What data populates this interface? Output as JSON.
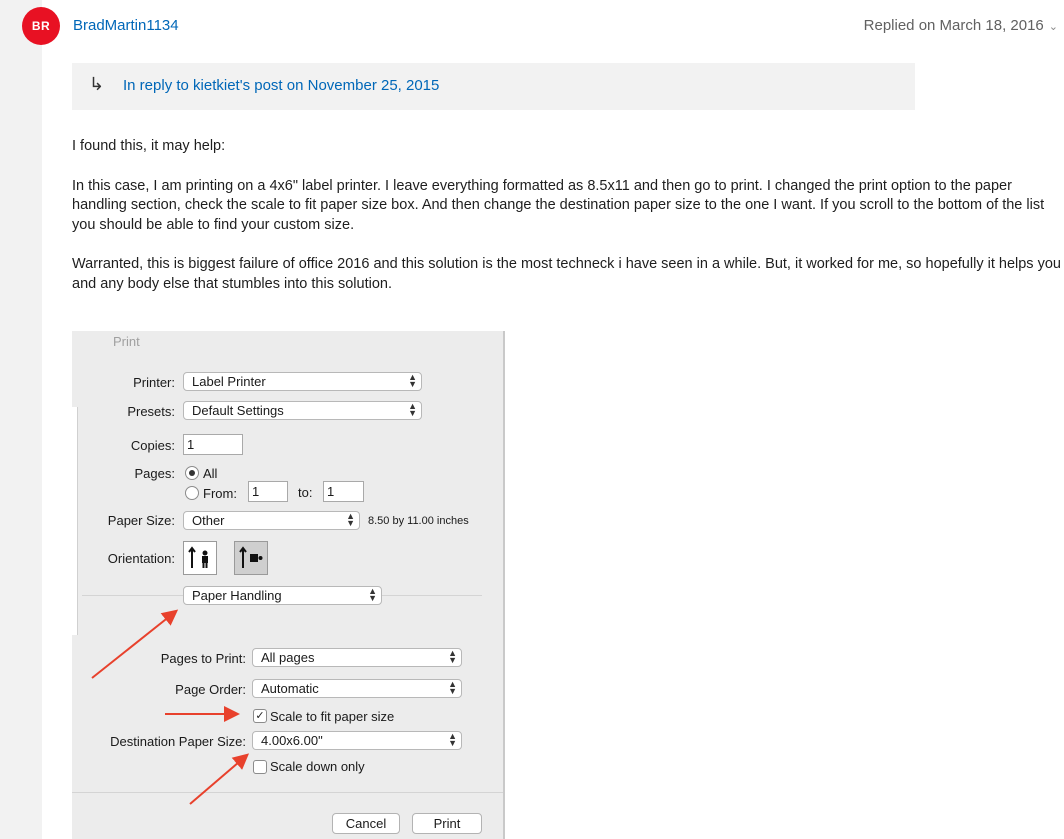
{
  "post": {
    "avatar_initials": "BR",
    "username": "BradMartin1134",
    "replied": "Replied on March 18, 2016",
    "reply_link": "In reply to kietkiet's post on November 25, 2015",
    "paragraphs": [
      "I found this, it may help:",
      "In this case, I am printing on a 4x6\" label printer. I leave everything formatted as 8.5x11 and then go to print. I changed the print option to the paper handling section, check the scale to fit paper size box. And then change the destination paper size to the one I want. If you scroll to the bottom of the list you should be able to find your custom size.",
      "Warranted, this is biggest failure of office 2016 and this solution is the most techneck i have seen in a while. But, it worked for me, so hopefully it helps you and any body else that stumbles into this solution."
    ],
    "colors": {
      "avatar": "#e81123",
      "link": "#0067b8",
      "arrow_annotation": "#e8412c"
    },
    "icons": [
      "reply-arrow-icon",
      "chevron-down-icon",
      "portrait-orientation-icon",
      "landscape-orientation-icon",
      "checkmark-icon"
    ]
  },
  "dialog": {
    "title": "Print",
    "printer_label": "Printer:",
    "printer_value": "Label Printer",
    "presets_label": "Presets:",
    "presets_value": "Default Settings",
    "copies_label": "Copies:",
    "copies_value": "1",
    "pages_label": "Pages:",
    "pages_all": "All",
    "pages_from": "From:",
    "pages_from_value": "1",
    "pages_to": "to:",
    "pages_to_value": "1",
    "paper_size_label": "Paper Size:",
    "paper_size_value": "Other",
    "paper_size_dims": "8.50 by 11.00 inches",
    "orientation_label": "Orientation:",
    "section_value": "Paper Handling",
    "pages_to_print_label": "Pages to Print:",
    "pages_to_print_value": "All pages",
    "page_order_label": "Page Order:",
    "page_order_value": "Automatic",
    "scale_fit_label": "Scale to fit paper size",
    "scale_fit_checked": true,
    "dest_size_label": "Destination Paper Size:",
    "dest_size_value": "4.00x6.00\"",
    "scale_down_label": "Scale down only",
    "scale_down_checked": false,
    "cancel_label": "Cancel",
    "print_label": "Print"
  }
}
